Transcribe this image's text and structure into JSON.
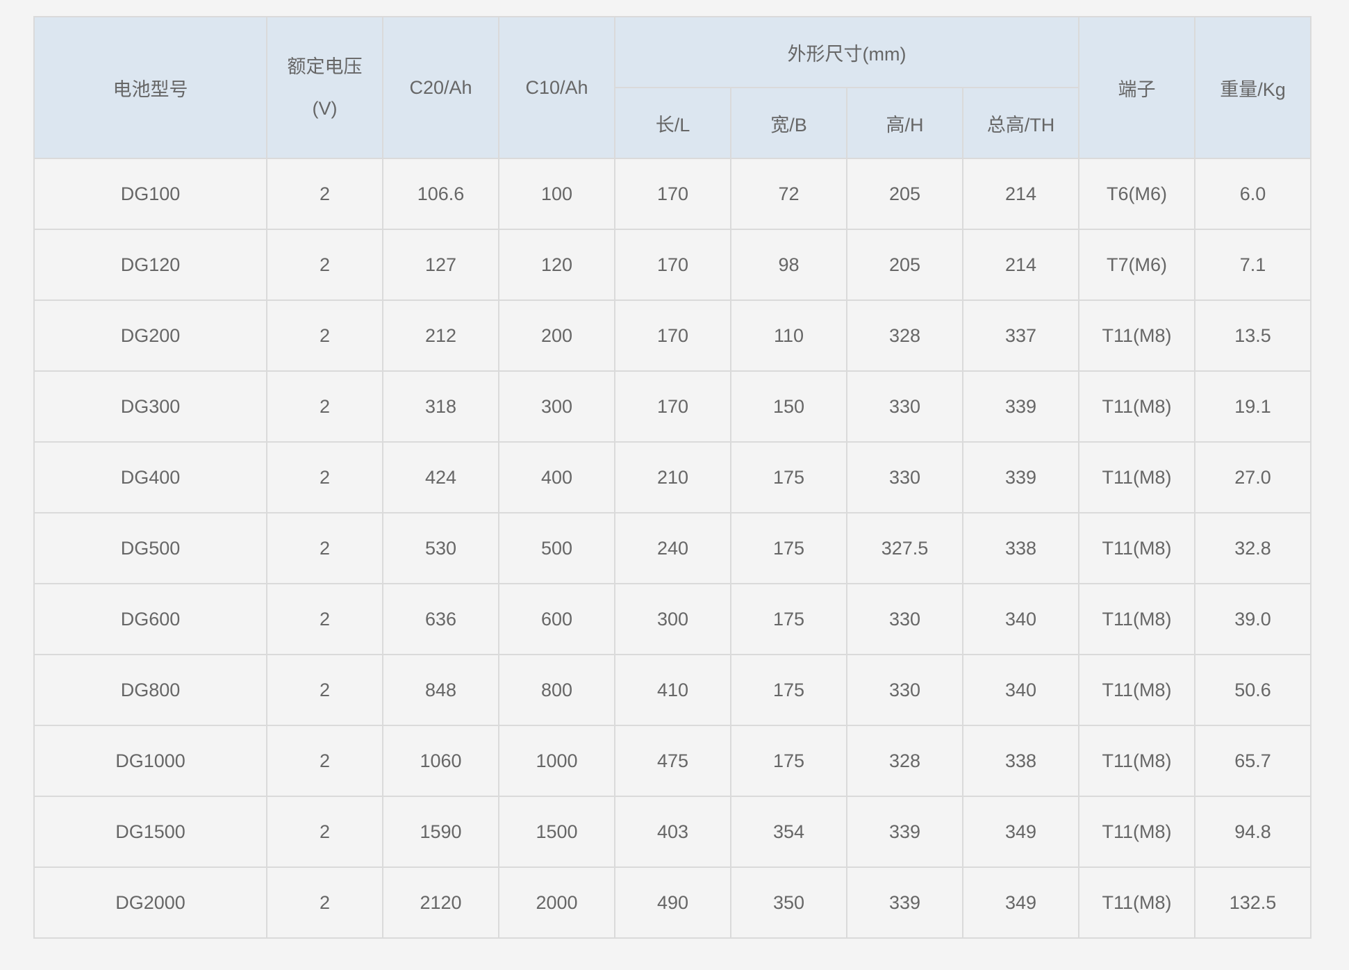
{
  "headers": {
    "model": "电池型号",
    "voltage_line1": "额定电压",
    "voltage_line2": "(V)",
    "c20": "C20/Ah",
    "c10": "C10/Ah",
    "dimensions": "外形尺寸(mm)",
    "length": "长/L",
    "width": "宽/B",
    "height": "高/H",
    "total_height": "总高/TH",
    "terminal": "端子",
    "weight": "重量/Kg"
  },
  "rows": [
    [
      "DG100",
      "2",
      "106.6",
      "100",
      "170",
      "72",
      "205",
      "214",
      "T6(M6)",
      "6.0"
    ],
    [
      "DG120",
      "2",
      "127",
      "120",
      "170",
      "98",
      "205",
      "214",
      "T7(M6)",
      "7.1"
    ],
    [
      "DG200",
      "2",
      "212",
      "200",
      "170",
      "110",
      "328",
      "337",
      "T11(M8)",
      "13.5"
    ],
    [
      "DG300",
      "2",
      "318",
      "300",
      "170",
      "150",
      "330",
      "339",
      "T11(M8)",
      "19.1"
    ],
    [
      "DG400",
      "2",
      "424",
      "400",
      "210",
      "175",
      "330",
      "339",
      "T11(M8)",
      "27.0"
    ],
    [
      "DG500",
      "2",
      "530",
      "500",
      "240",
      "175",
      "327.5",
      "338",
      "T11(M8)",
      "32.8"
    ],
    [
      "DG600",
      "2",
      "636",
      "600",
      "300",
      "175",
      "330",
      "340",
      "T11(M8)",
      "39.0"
    ],
    [
      "DG800",
      "2",
      "848",
      "800",
      "410",
      "175",
      "330",
      "340",
      "T11(M8)",
      "50.6"
    ],
    [
      "DG1000",
      "2",
      "1060",
      "1000",
      "475",
      "175",
      "328",
      "338",
      "T11(M8)",
      "65.7"
    ],
    [
      "DG1500",
      "2",
      "1590",
      "1500",
      "403",
      "354",
      "339",
      "349",
      "T11(M8)",
      "94.8"
    ],
    [
      "DG2000",
      "2",
      "2120",
      "2000",
      "490",
      "350",
      "339",
      "349",
      "T11(M8)",
      "132.5"
    ]
  ]
}
